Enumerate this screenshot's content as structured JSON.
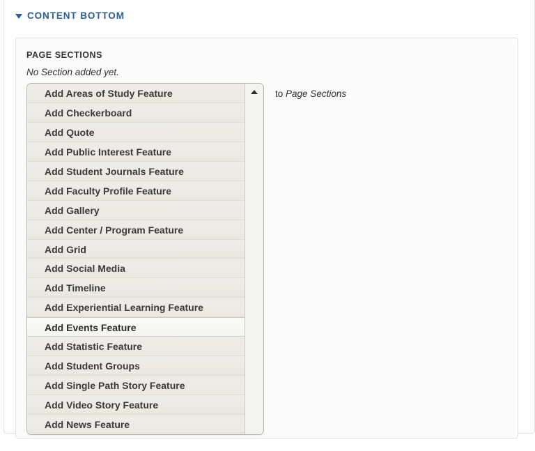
{
  "section": {
    "header_label": "CONTENT BOTTOM",
    "disclosure_icon": "triangle-down-icon",
    "expanded": true
  },
  "panel": {
    "title": "PAGE SECTIONS",
    "empty_message": "No Section added yet."
  },
  "add_control": {
    "to_prefix": "to",
    "target_label": "Page Sections",
    "scroll_up_icon": "triangle-up-icon",
    "selected_index": 12,
    "options": [
      "Add Areas of Study Feature",
      "Add Checkerboard",
      "Add Quote",
      "Add Public Interest Feature",
      "Add Student Journals Feature",
      "Add Faculty Profile Feature",
      "Add Gallery",
      "Add Center / Program Feature",
      "Add Grid",
      "Add Social Media",
      "Add Timeline",
      "Add Experiential Learning Feature",
      "Add Events Feature",
      "Add Statistic Feature",
      "Add Student Groups",
      "Add Single Path Story Feature",
      "Add Video Story Feature",
      "Add News Feature"
    ]
  },
  "colors": {
    "header_blue": "#2c5f94",
    "panel_background": "#fcfcfa",
    "option_background": "#eeece6",
    "option_selected_background": "#fbfbf9",
    "text_dark": "#3b3a38",
    "border_grey": "#b4b2ac"
  }
}
